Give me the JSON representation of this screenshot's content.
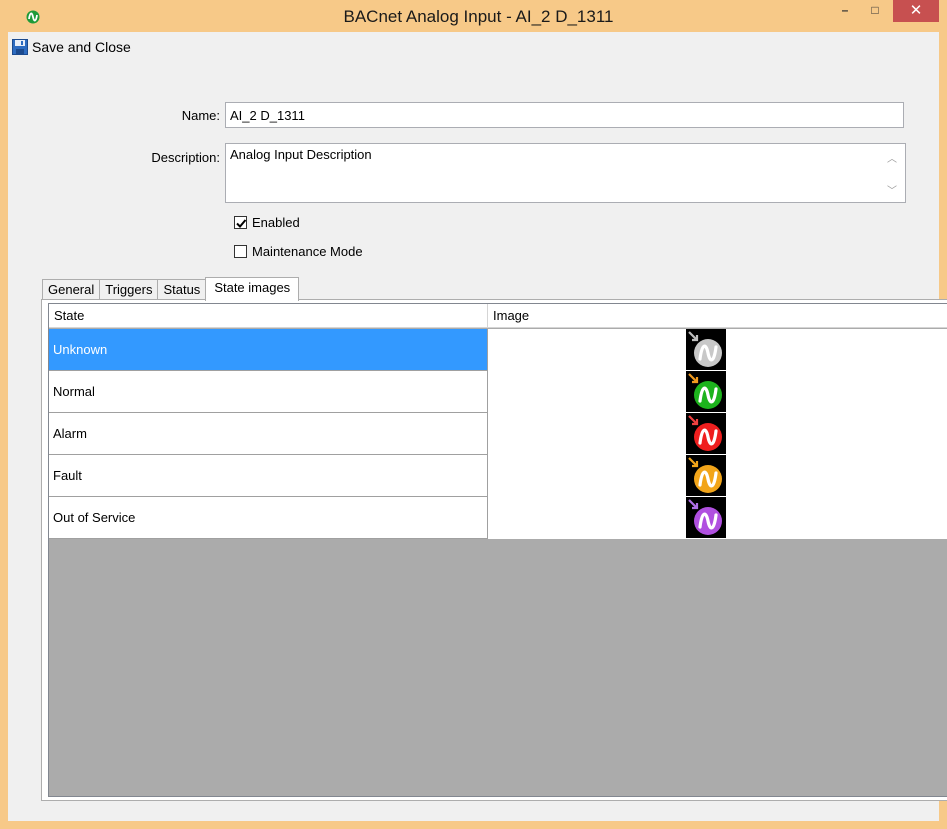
{
  "window": {
    "title": "BACnet Analog Input  -  AI_2 D_1311",
    "min_symbol": "–",
    "max_symbol": "□",
    "close_symbol": "✕"
  },
  "toolbar": {
    "save_close_label": "Save and Close"
  },
  "form": {
    "name_label": "Name:",
    "name_value": "AI_2 D_1311",
    "description_label": "Description:",
    "description_value": "Analog Input Description",
    "enabled_label": "Enabled",
    "enabled_checked": true,
    "maintenance_label": "Maintenance Mode",
    "maintenance_checked": false
  },
  "tabs": [
    {
      "label": "General",
      "active": false
    },
    {
      "label": "Triggers",
      "active": false
    },
    {
      "label": "Status",
      "active": false
    },
    {
      "label": "State images",
      "active": true
    }
  ],
  "grid": {
    "columns": [
      "State",
      "Image"
    ],
    "rows": [
      {
        "state": "Unknown",
        "color": "#c8c8c8",
        "arrow": "#bfbfbf",
        "selected": true
      },
      {
        "state": "Normal",
        "color": "#1db31d",
        "arrow": "#f29b1f",
        "selected": false
      },
      {
        "state": "Alarm",
        "color": "#ef1f1f",
        "arrow": "#ef4040",
        "selected": false
      },
      {
        "state": "Fault",
        "color": "#f2a51a",
        "arrow": "#f2a51a",
        "selected": false
      },
      {
        "state": "Out of Service",
        "color": "#b050e0",
        "arrow": "#b070e8",
        "selected": false
      }
    ]
  },
  "colors": {
    "window_frame": "#f7c988",
    "selection": "#3399ff",
    "close_button": "#c75050",
    "empty_grid": "#ababab"
  },
  "icons": {
    "app": "bacnet-app-icon",
    "save": "floppy-disk-icon",
    "state": "bacnet-analog-state-icon"
  }
}
